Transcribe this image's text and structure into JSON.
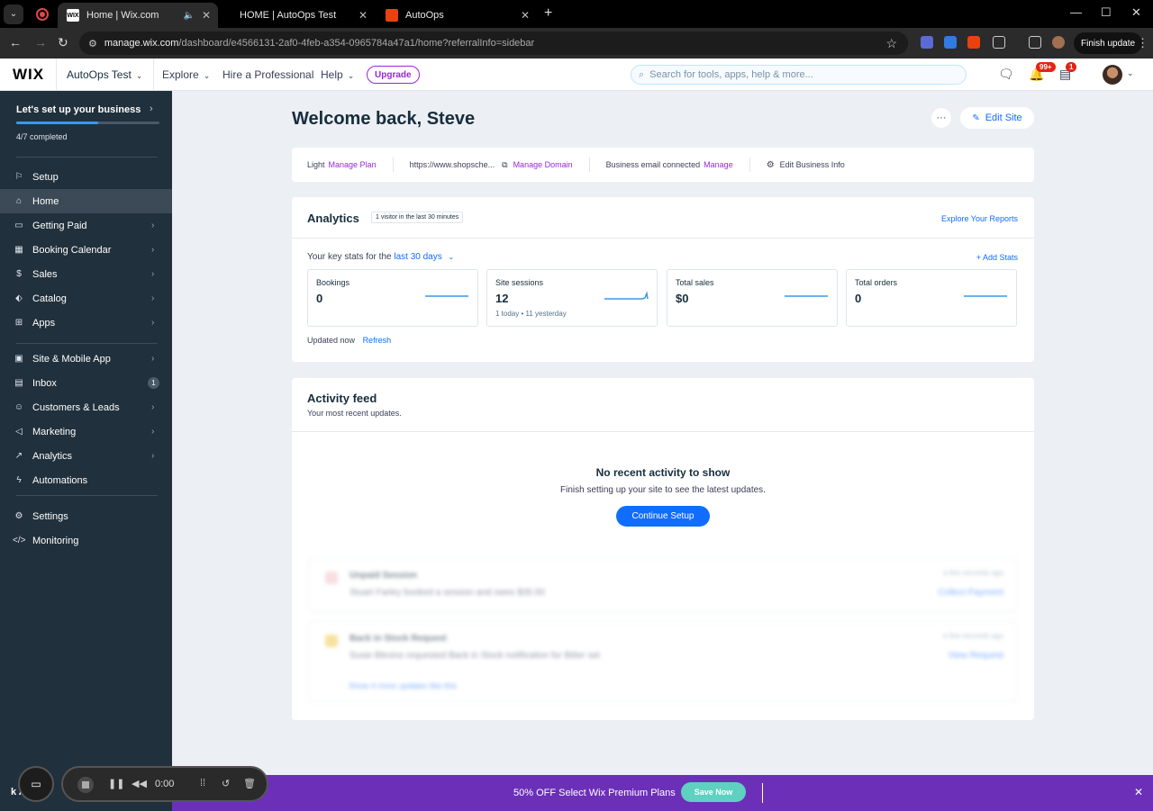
{
  "browser": {
    "tabs": [
      {
        "title": "Home | Wix.com",
        "favicon": "WIX"
      },
      {
        "title": "HOME | AutoOps Test",
        "favicon": ""
      },
      {
        "title": "AutoOps",
        "favicon": ""
      }
    ],
    "url_host": "manage.wix.com",
    "url_path": "/dashboard/e4566131-2af0-4feb-a354-0965784a47a1/home?referralInfo=sidebar",
    "finish_update": "Finish update"
  },
  "topbar": {
    "logo": "WIX",
    "site_name": "AutoOps Test",
    "explore": "Explore",
    "hire": "Hire a Professional",
    "help": "Help",
    "upgrade": "Upgrade",
    "search_placeholder": "Search for tools, apps, help & more...",
    "notif_badge": "99+",
    "inbox_badge": "1"
  },
  "sidebar": {
    "setup_title": "Let's set up your business",
    "progress_text": "4/7 completed",
    "progress_fraction": 0.57,
    "items": [
      {
        "label": "Setup",
        "icon": "rocket-icon",
        "arrow": false
      },
      {
        "label": "Home",
        "icon": "home-icon",
        "arrow": false
      },
      {
        "label": "Getting Paid",
        "icon": "credit-card-icon",
        "arrow": true
      },
      {
        "label": "Booking Calendar",
        "icon": "calendar-icon",
        "arrow": true
      },
      {
        "label": "Sales",
        "icon": "dollar-icon",
        "arrow": true
      },
      {
        "label": "Catalog",
        "icon": "tag-icon",
        "arrow": true
      },
      {
        "label": "Apps",
        "icon": "apps-icon",
        "arrow": true
      },
      {
        "label": "Site & Mobile App",
        "icon": "window-icon",
        "arrow": true
      },
      {
        "label": "Inbox",
        "icon": "inbox-icon",
        "count": "1"
      },
      {
        "label": "Customers & Leads",
        "icon": "people-icon",
        "arrow": true
      },
      {
        "label": "Marketing",
        "icon": "megaphone-icon",
        "arrow": true
      },
      {
        "label": "Analytics",
        "icon": "chart-icon",
        "arrow": true
      },
      {
        "label": "Automations",
        "icon": "lightning-icon",
        "arrow": false
      },
      {
        "label": "Settings",
        "icon": "gear-icon",
        "arrow": false
      },
      {
        "label": "Monitoring",
        "icon": "code-icon",
        "arrow": false
      }
    ]
  },
  "main": {
    "welcome": "Welcome back, Steve",
    "more": "···",
    "edit_site": "Edit Site",
    "info": {
      "plan": "Light",
      "manage_plan": "Manage Plan",
      "domain": "https://www.shopsche...",
      "manage_domain": "Manage Domain",
      "email": "Business email connected",
      "manage_email": "Manage",
      "edit_business": "Edit Business Info"
    },
    "analytics": {
      "title": "Analytics",
      "pill": "1 visitor in the last 30 minutes",
      "explore": "Explore Your Reports",
      "key_stats": "Your key stats for the",
      "range": "last 30 days",
      "add_stats": "Add Stats",
      "stats": [
        {
          "label": "Bookings",
          "value": "0",
          "sub": ""
        },
        {
          "label": "Site sessions",
          "value": "12",
          "sub": "1 today  •  11 yesterday"
        },
        {
          "label": "Total sales",
          "value": "$0",
          "sub": ""
        },
        {
          "label": "Total orders",
          "value": "0",
          "sub": ""
        }
      ],
      "updated": "Updated now",
      "refresh": "Refresh"
    },
    "feed": {
      "title": "Activity feed",
      "subtitle": "Your most recent updates.",
      "empty_title": "No recent activity to show",
      "empty_sub": "Finish setting up your site to see the latest updates.",
      "continue": "Continue Setup",
      "preview": [
        {
          "title": "Unpaid Session",
          "desc": "Stuart Farley booked a session and owes $35.50",
          "time": "a few seconds ago",
          "link": "Collect Payment"
        },
        {
          "title": "Back in Stock Request",
          "desc": "Susie Blevins requested Back in Stock notification for Bitter set",
          "time": "a few seconds ago",
          "link": "View Request"
        }
      ],
      "more_updates": "Show 4 more updates like this"
    }
  },
  "promo": {
    "text": "50% OFF Select Wix Premium Plans",
    "button": "Save Now"
  },
  "recorder": {
    "time": "0:00",
    "under_text": "k Ac"
  },
  "colors": {
    "sidebar_bg": "#20303c",
    "accent_blue": "#116dff",
    "upgrade_purple": "#9a27d5",
    "promo_purple": "#6c30b8",
    "save_teal": "#5ed1c0"
  }
}
